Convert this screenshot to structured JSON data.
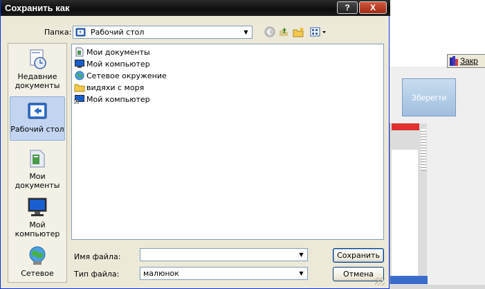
{
  "dialog": {
    "title": "Сохранить как",
    "help_glyph": "?",
    "close_glyph": "X",
    "folder_label": "Папка:",
    "folder_value": "Рабочий стол",
    "places": [
      {
        "label": "Недавние документы",
        "icon": "recent-documents-icon"
      },
      {
        "label": "Рабочий стол",
        "icon": "desktop-icon",
        "selected": true
      },
      {
        "label": "Мои документы",
        "icon": "my-documents-icon"
      },
      {
        "label": "Мой компьютер",
        "icon": "my-computer-icon"
      },
      {
        "label": "Сетевое",
        "icon": "network-icon"
      }
    ],
    "files": [
      {
        "name": "Мои документы",
        "icon": "my-documents-icon"
      },
      {
        "name": "Мой компьютер",
        "icon": "computer-icon"
      },
      {
        "name": "Сетевое окружение",
        "icon": "network-icon"
      },
      {
        "name": "видяхи с моря",
        "icon": "folder-icon"
      },
      {
        "name": "Мой компьютер",
        "icon": "computer-shortcut-icon"
      }
    ],
    "filename_label": "Имя файла:",
    "filename_value": "",
    "filetype_label": "Тип файла:",
    "filetype_value": "малюнок",
    "save_button": "Сохранить",
    "cancel_button": "Отмена"
  },
  "background": {
    "close_button": "Закр",
    "save_button": "Зберегти"
  },
  "colors": {
    "titlebar": "#1a1a1a",
    "dialog_bg": "#ece9d8",
    "selection": "#c2d4ef",
    "accent_blue": "#0831d9"
  }
}
